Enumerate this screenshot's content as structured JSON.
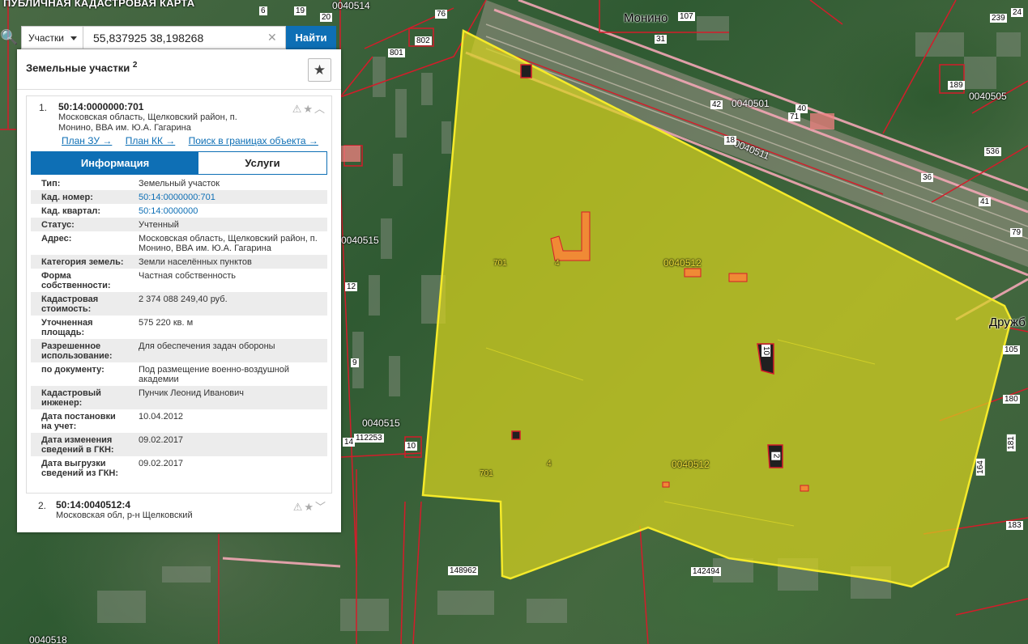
{
  "app": {
    "title": "ПУБЛИЧНАЯ КАДАСТРОВАЯ КАРТА"
  },
  "search": {
    "type_label": "Участки",
    "query": "55,837925 38,198268",
    "find_label": "Найти",
    "clear_glyph": "✕",
    "search_glyph": "🔍"
  },
  "panel": {
    "title": "Земельные участки",
    "count": "2",
    "fav_glyph": "★",
    "results": [
      {
        "num": "1.",
        "cad": "50:14:0000000:701",
        "address": "Московская область, Щелковский район, п. Монино, ВВА им. Ю.А. Гагарина",
        "icons": "⚠★︿",
        "links": [
          "План ЗУ →",
          "План КК →",
          "Поиск в границах объекта →"
        ],
        "tabs": {
          "info": "Информация",
          "services": "Услуги"
        },
        "attributes": [
          {
            "k": "Тип:",
            "v": "Земельный участок"
          },
          {
            "k": "Кад. номер:",
            "v": "50:14:0000000:701"
          },
          {
            "k": "Кад. квартал:",
            "v": "50:14:0000000"
          },
          {
            "k": "Статус:",
            "v": "Учтенный"
          },
          {
            "k": "Адрес:",
            "v": "Московская область, Щелковский район, п. Монино, ВВА им. Ю.А. Гагарина"
          },
          {
            "k": "Категория земель:",
            "v": "Земли населённых пунктов"
          },
          {
            "k": "Форма собственности:",
            "v": "Частная собственность"
          },
          {
            "k": "Кадастровая стоимость:",
            "v": "2 374 088 249,40 руб."
          },
          {
            "k": "Уточненная площадь:",
            "v": "575 220 кв. м"
          },
          {
            "k": "Разрешенное использование:",
            "v": "Для обеспечения задач обороны"
          },
          {
            "k": "по документу:",
            "v": "Под размещение военно-воздушной академии"
          },
          {
            "k": "Кадастровый инженер:",
            "v": "Пунчик Леонид Иванович"
          },
          {
            "k": "Дата постановки на учет:",
            "v": "10.04.2012"
          },
          {
            "k": "Дата изменения сведений в ГКН:",
            "v": "09.02.2017"
          },
          {
            "k": "Дата выгрузки сведений из ГКН:",
            "v": "09.02.2017"
          }
        ]
      },
      {
        "num": "2.",
        "cad": "50:14:0040512:4",
        "address": "Московская обл, р-н Щелковский",
        "icons": "⚠★﹀"
      }
    ]
  },
  "map": {
    "labels": {
      "place_monino": "Монино",
      "place_druzh": "Дружб",
      "q_0040514": "0040514",
      "q_0040501": "0040501",
      "q_0040505": "0040505",
      "q_0040511": "0040511",
      "q_0040515a": "0040515",
      "q_0040515b": "0040515",
      "q_0040512a": "0040512",
      "q_0040512b": "0040512",
      "q_0040518": "0040518",
      "p_701a": "701",
      "p_701b": "701",
      "p_4a": "4",
      "p_4b": "4",
      "p_10": "10",
      "p_2": "2",
      "p_112253": "112253",
      "p_148962": "148962",
      "p_142494": "142494",
      "n_107": "107",
      "n_76": "76",
      "n_802": "802",
      "n_801": "801",
      "n_42": "42",
      "n_40": "40",
      "n_71": "71",
      "n_18": "18",
      "n_36": "36",
      "n_41": "41",
      "n_189": "189",
      "n_536": "536",
      "n_12": "12",
      "n_9": "9",
      "n_10b": "10",
      "n_14": "14",
      "n_105": "105",
      "n_180": "180",
      "n_181": "181",
      "n_164": "164",
      "n_183": "183",
      "n_79": "79",
      "n_24": "24",
      "n_239": "239",
      "n_6": "6",
      "n_19": "19",
      "n_31": "31",
      "n_20": "20"
    }
  }
}
